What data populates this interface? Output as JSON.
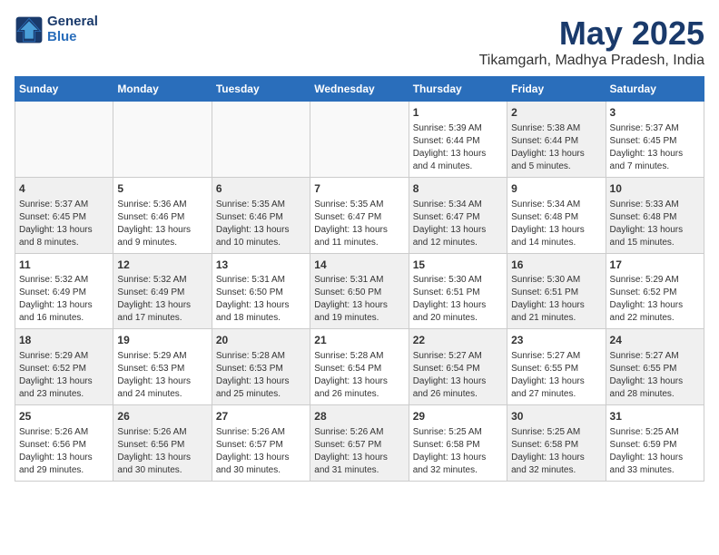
{
  "header": {
    "logo_general": "General",
    "logo_blue": "Blue",
    "month": "May 2025",
    "location": "Tikamgarh, Madhya Pradesh, India"
  },
  "weekdays": [
    "Sunday",
    "Monday",
    "Tuesday",
    "Wednesday",
    "Thursday",
    "Friday",
    "Saturday"
  ],
  "weeks": [
    [
      {
        "day": "",
        "info": "",
        "empty": true
      },
      {
        "day": "",
        "info": "",
        "empty": true
      },
      {
        "day": "",
        "info": "",
        "empty": true
      },
      {
        "day": "",
        "info": "",
        "empty": true
      },
      {
        "day": "1",
        "info": "Sunrise: 5:39 AM\nSunset: 6:44 PM\nDaylight: 13 hours\nand 4 minutes.",
        "empty": false,
        "shaded": false
      },
      {
        "day": "2",
        "info": "Sunrise: 5:38 AM\nSunset: 6:44 PM\nDaylight: 13 hours\nand 5 minutes.",
        "empty": false,
        "shaded": true
      },
      {
        "day": "3",
        "info": "Sunrise: 5:37 AM\nSunset: 6:45 PM\nDaylight: 13 hours\nand 7 minutes.",
        "empty": false,
        "shaded": false
      }
    ],
    [
      {
        "day": "4",
        "info": "Sunrise: 5:37 AM\nSunset: 6:45 PM\nDaylight: 13 hours\nand 8 minutes.",
        "empty": false,
        "shaded": true
      },
      {
        "day": "5",
        "info": "Sunrise: 5:36 AM\nSunset: 6:46 PM\nDaylight: 13 hours\nand 9 minutes.",
        "empty": false,
        "shaded": false
      },
      {
        "day": "6",
        "info": "Sunrise: 5:35 AM\nSunset: 6:46 PM\nDaylight: 13 hours\nand 10 minutes.",
        "empty": false,
        "shaded": true
      },
      {
        "day": "7",
        "info": "Sunrise: 5:35 AM\nSunset: 6:47 PM\nDaylight: 13 hours\nand 11 minutes.",
        "empty": false,
        "shaded": false
      },
      {
        "day": "8",
        "info": "Sunrise: 5:34 AM\nSunset: 6:47 PM\nDaylight: 13 hours\nand 12 minutes.",
        "empty": false,
        "shaded": true
      },
      {
        "day": "9",
        "info": "Sunrise: 5:34 AM\nSunset: 6:48 PM\nDaylight: 13 hours\nand 14 minutes.",
        "empty": false,
        "shaded": false
      },
      {
        "day": "10",
        "info": "Sunrise: 5:33 AM\nSunset: 6:48 PM\nDaylight: 13 hours\nand 15 minutes.",
        "empty": false,
        "shaded": true
      }
    ],
    [
      {
        "day": "11",
        "info": "Sunrise: 5:32 AM\nSunset: 6:49 PM\nDaylight: 13 hours\nand 16 minutes.",
        "empty": false,
        "shaded": false
      },
      {
        "day": "12",
        "info": "Sunrise: 5:32 AM\nSunset: 6:49 PM\nDaylight: 13 hours\nand 17 minutes.",
        "empty": false,
        "shaded": true
      },
      {
        "day": "13",
        "info": "Sunrise: 5:31 AM\nSunset: 6:50 PM\nDaylight: 13 hours\nand 18 minutes.",
        "empty": false,
        "shaded": false
      },
      {
        "day": "14",
        "info": "Sunrise: 5:31 AM\nSunset: 6:50 PM\nDaylight: 13 hours\nand 19 minutes.",
        "empty": false,
        "shaded": true
      },
      {
        "day": "15",
        "info": "Sunrise: 5:30 AM\nSunset: 6:51 PM\nDaylight: 13 hours\nand 20 minutes.",
        "empty": false,
        "shaded": false
      },
      {
        "day": "16",
        "info": "Sunrise: 5:30 AM\nSunset: 6:51 PM\nDaylight: 13 hours\nand 21 minutes.",
        "empty": false,
        "shaded": true
      },
      {
        "day": "17",
        "info": "Sunrise: 5:29 AM\nSunset: 6:52 PM\nDaylight: 13 hours\nand 22 minutes.",
        "empty": false,
        "shaded": false
      }
    ],
    [
      {
        "day": "18",
        "info": "Sunrise: 5:29 AM\nSunset: 6:52 PM\nDaylight: 13 hours\nand 23 minutes.",
        "empty": false,
        "shaded": true
      },
      {
        "day": "19",
        "info": "Sunrise: 5:29 AM\nSunset: 6:53 PM\nDaylight: 13 hours\nand 24 minutes.",
        "empty": false,
        "shaded": false
      },
      {
        "day": "20",
        "info": "Sunrise: 5:28 AM\nSunset: 6:53 PM\nDaylight: 13 hours\nand 25 minutes.",
        "empty": false,
        "shaded": true
      },
      {
        "day": "21",
        "info": "Sunrise: 5:28 AM\nSunset: 6:54 PM\nDaylight: 13 hours\nand 26 minutes.",
        "empty": false,
        "shaded": false
      },
      {
        "day": "22",
        "info": "Sunrise: 5:27 AM\nSunset: 6:54 PM\nDaylight: 13 hours\nand 26 minutes.",
        "empty": false,
        "shaded": true
      },
      {
        "day": "23",
        "info": "Sunrise: 5:27 AM\nSunset: 6:55 PM\nDaylight: 13 hours\nand 27 minutes.",
        "empty": false,
        "shaded": false
      },
      {
        "day": "24",
        "info": "Sunrise: 5:27 AM\nSunset: 6:55 PM\nDaylight: 13 hours\nand 28 minutes.",
        "empty": false,
        "shaded": true
      }
    ],
    [
      {
        "day": "25",
        "info": "Sunrise: 5:26 AM\nSunset: 6:56 PM\nDaylight: 13 hours\nand 29 minutes.",
        "empty": false,
        "shaded": false
      },
      {
        "day": "26",
        "info": "Sunrise: 5:26 AM\nSunset: 6:56 PM\nDaylight: 13 hours\nand 30 minutes.",
        "empty": false,
        "shaded": true
      },
      {
        "day": "27",
        "info": "Sunrise: 5:26 AM\nSunset: 6:57 PM\nDaylight: 13 hours\nand 30 minutes.",
        "empty": false,
        "shaded": false
      },
      {
        "day": "28",
        "info": "Sunrise: 5:26 AM\nSunset: 6:57 PM\nDaylight: 13 hours\nand 31 minutes.",
        "empty": false,
        "shaded": true
      },
      {
        "day": "29",
        "info": "Sunrise: 5:25 AM\nSunset: 6:58 PM\nDaylight: 13 hours\nand 32 minutes.",
        "empty": false,
        "shaded": false
      },
      {
        "day": "30",
        "info": "Sunrise: 5:25 AM\nSunset: 6:58 PM\nDaylight: 13 hours\nand 32 minutes.",
        "empty": false,
        "shaded": true
      },
      {
        "day": "31",
        "info": "Sunrise: 5:25 AM\nSunset: 6:59 PM\nDaylight: 13 hours\nand 33 minutes.",
        "empty": false,
        "shaded": false
      }
    ]
  ]
}
